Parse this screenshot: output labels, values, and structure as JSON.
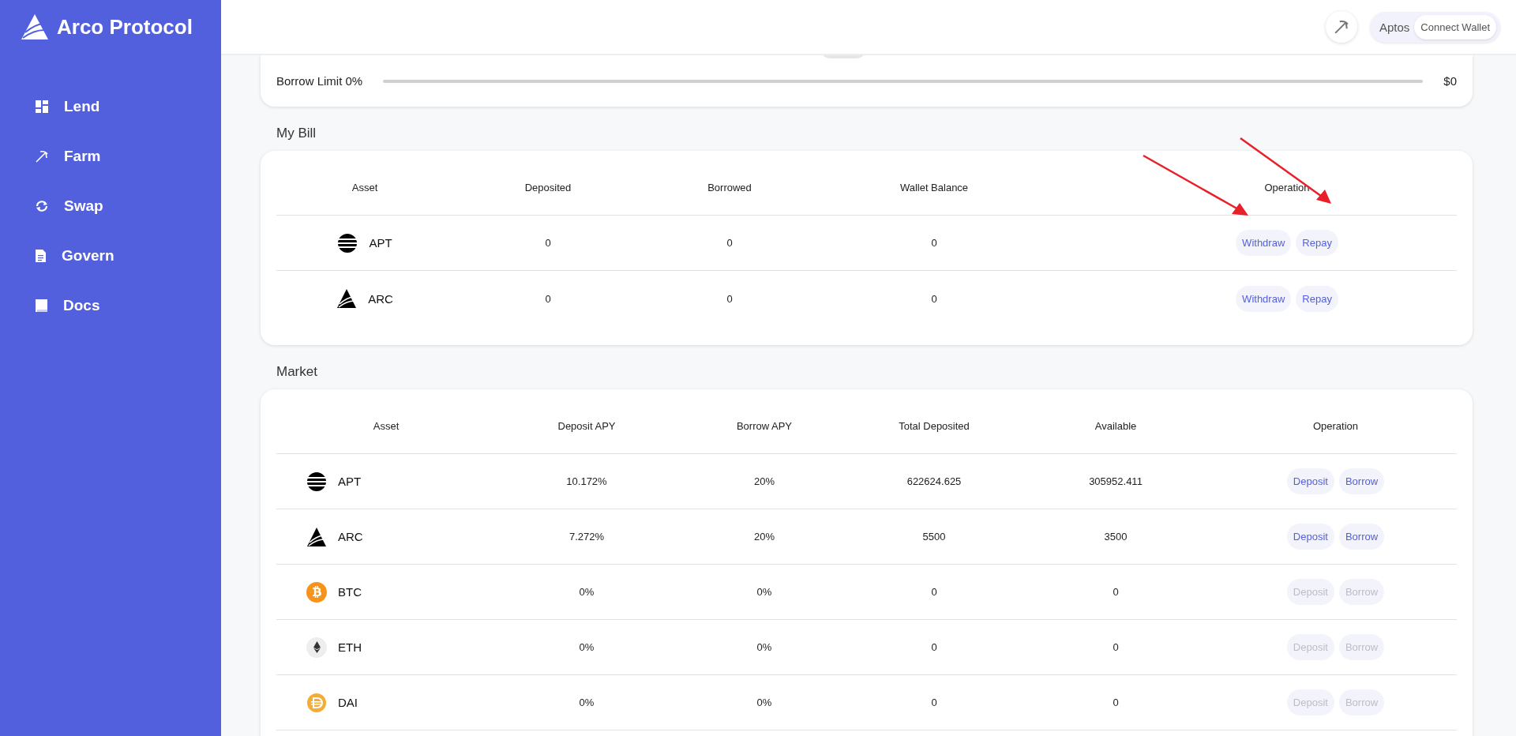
{
  "brand": {
    "name": "Arco Protocol"
  },
  "sidebar": {
    "items": [
      {
        "label": "Lend"
      },
      {
        "label": "Farm"
      },
      {
        "label": "Swap"
      },
      {
        "label": "Govern"
      },
      {
        "label": "Docs"
      }
    ]
  },
  "header": {
    "network": "Aptos",
    "connect_button": "Connect Wallet"
  },
  "borrow_limit": {
    "label": "Borrow Limit 0%",
    "level": 0,
    "value": "$0"
  },
  "my_bill": {
    "title": "My Bill",
    "columns": [
      "Asset",
      "Deposited",
      "Borrowed",
      "Wallet Balance",
      "Operation"
    ],
    "rows": [
      {
        "asset": "APT",
        "deposited": "0",
        "borrowed": "0",
        "wallet_balance": "0",
        "actions": [
          "Withdraw",
          "Repay"
        ]
      },
      {
        "asset": "ARC",
        "deposited": "0",
        "borrowed": "0",
        "wallet_balance": "0",
        "actions": [
          "Withdraw",
          "Repay"
        ]
      }
    ]
  },
  "market": {
    "title": "Market",
    "columns": [
      "Asset",
      "Deposit APY",
      "Borrow APY",
      "Total Deposited",
      "Available",
      "Operation"
    ],
    "rows": [
      {
        "asset": "APT",
        "deposit_apy": "10.172%",
        "borrow_apy": "20%",
        "total_deposited": "622624.625",
        "available": "305952.411",
        "actions": [
          "Deposit",
          "Borrow"
        ],
        "disabled": false
      },
      {
        "asset": "ARC",
        "deposit_apy": "7.272%",
        "borrow_apy": "20%",
        "total_deposited": "5500",
        "available": "3500",
        "actions": [
          "Deposit",
          "Borrow"
        ],
        "disabled": false
      },
      {
        "asset": "BTC",
        "deposit_apy": "0%",
        "borrow_apy": "0%",
        "total_deposited": "0",
        "available": "0",
        "actions": [
          "Deposit",
          "Borrow"
        ],
        "disabled": true
      },
      {
        "asset": "ETH",
        "deposit_apy": "0%",
        "borrow_apy": "0%",
        "total_deposited": "0",
        "available": "0",
        "actions": [
          "Deposit",
          "Borrow"
        ],
        "disabled": true
      },
      {
        "asset": "DAI",
        "deposit_apy": "0%",
        "borrow_apy": "0%",
        "total_deposited": "0",
        "available": "0",
        "actions": [
          "Deposit",
          "Borrow"
        ],
        "disabled": true
      }
    ]
  }
}
